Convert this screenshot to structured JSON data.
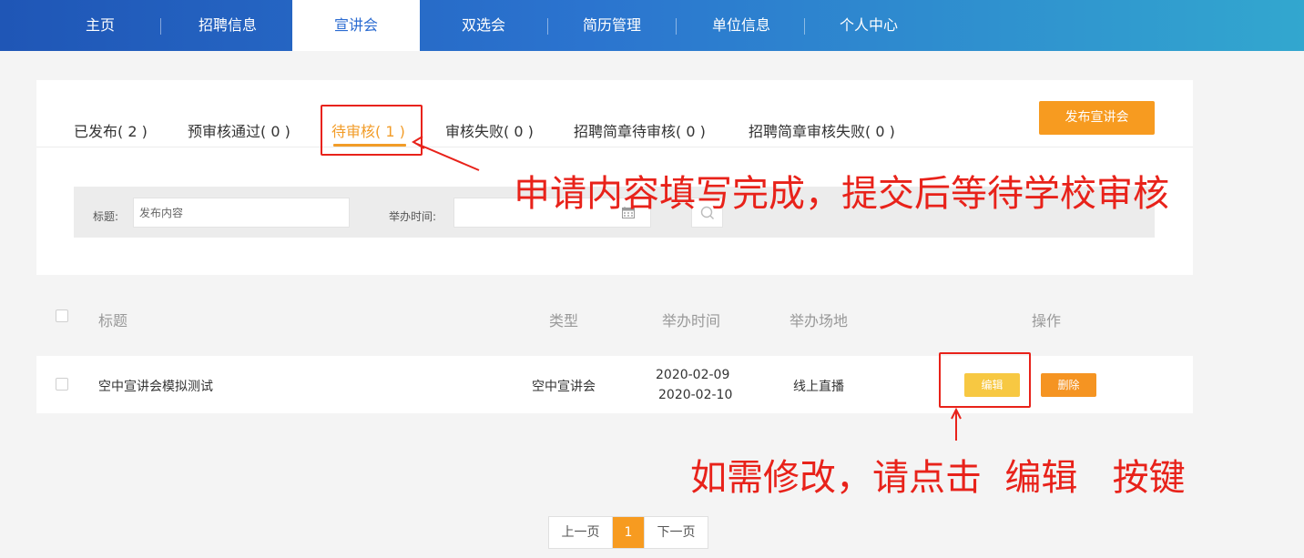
{
  "nav": {
    "items": [
      {
        "label": "主页"
      },
      {
        "label": "招聘信息"
      },
      {
        "label": "宣讲会",
        "active": true
      },
      {
        "label": "双选会"
      },
      {
        "label": "简历管理"
      },
      {
        "label": "单位信息"
      },
      {
        "label": "个人中心"
      }
    ]
  },
  "tabs": [
    {
      "label": "已发布( 2 )"
    },
    {
      "label": "预审核通过( 0 )"
    },
    {
      "label": "待审核( 1 )",
      "active": true
    },
    {
      "label": "审核失败( 0 )"
    },
    {
      "label": "招聘简章待审核( 0 )"
    },
    {
      "label": "招聘简章审核失败( 0 )"
    }
  ],
  "publish_button": "发布宣讲会",
  "filter": {
    "title_label": "标题:",
    "title_placeholder": "发布内容",
    "time_label": "举办时间:",
    "time_value": ""
  },
  "table": {
    "headers": {
      "title": "标题",
      "type": "类型",
      "time": "举办时间",
      "venue": "举办场地",
      "actions": "操作"
    },
    "rows": [
      {
        "title": "空中宣讲会模拟测试",
        "type": "空中宣讲会",
        "time_start": "2020-02-09",
        "time_end": "2020-02-10",
        "venue": "线上直播",
        "edit": "编辑",
        "delete": "删除"
      }
    ]
  },
  "pagination": {
    "prev": "上一页",
    "current": "1",
    "next": "下一页"
  },
  "annotations": {
    "note1": "申请内容填写完成，提交后等待学校审核",
    "note2": "如需修改，请点击  编辑   按键"
  },
  "colors": {
    "accent": "#f79b20",
    "nav_active": "#2b6bd1",
    "annotation": "#e8221a"
  }
}
